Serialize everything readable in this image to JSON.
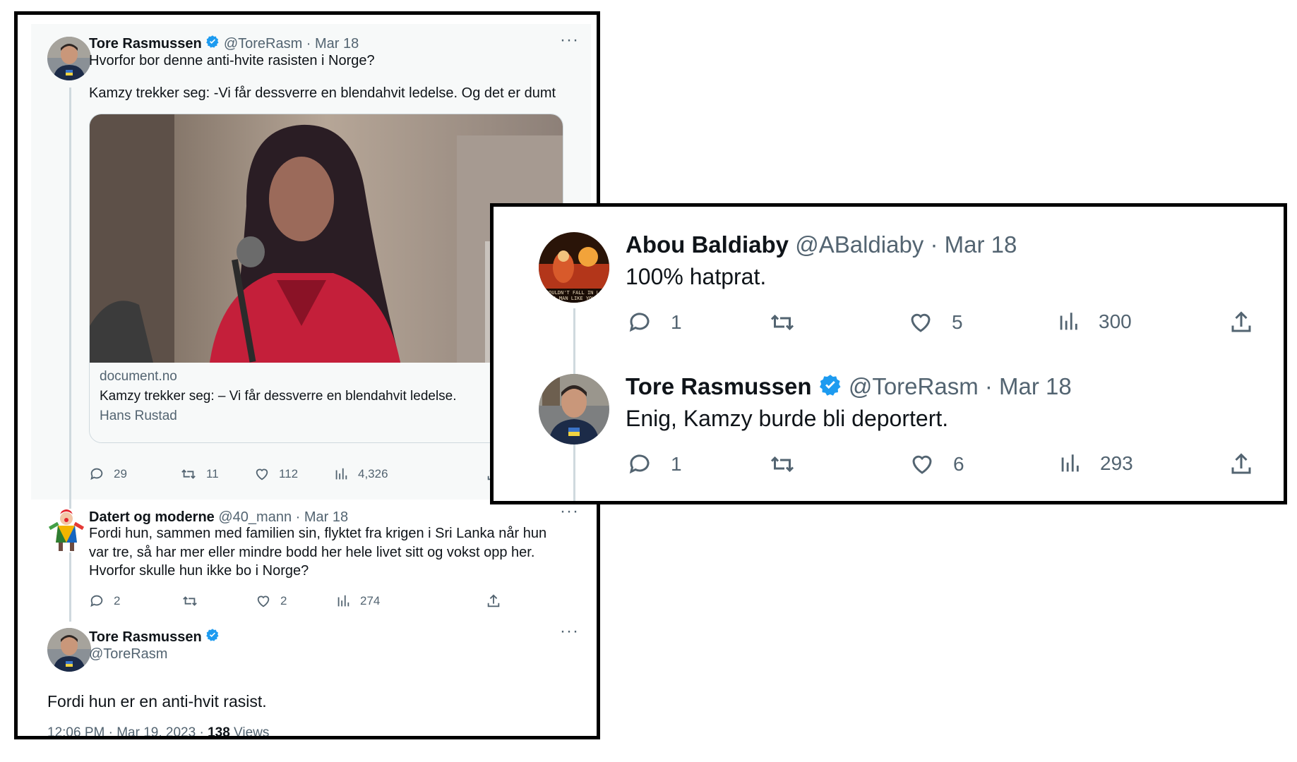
{
  "left": {
    "tweet1": {
      "name": "Tore Rasmussen",
      "handle_date": "@ToreRasm · Mar 18",
      "text_line1": "Hvorfor bor denne anti-hvite rasisten i Norge?",
      "text_line2": "Kamzy trekker seg: -Vi får dessverre en blendahvit ledelse. Og det er dumt",
      "card": {
        "domain": "document.no",
        "title": "Kamzy trekker seg: – Vi får dessverre en blendahvit ledelse.",
        "author": "Hans Rustad"
      },
      "replies": "29",
      "retweets": "11",
      "likes": "112",
      "views": "4,326"
    },
    "tweet2": {
      "name": "Datert og moderne",
      "handle_date": "@40_mann · Mar 18",
      "line1": "Fordi hun, sammen med familien sin, flyktet fra krigen i Sri Lanka når hun",
      "line2": "var tre, så har mer eller mindre bodd her hele livet sitt og vokst opp her.",
      "line3": "Hvorfor skulle hun ikke bo i Norge?",
      "replies": "2",
      "likes": "2",
      "views": "274"
    },
    "tweet3": {
      "name": "Tore Rasmussen",
      "handle": "@ToreRasm",
      "text": "Fordi hun er en anti-hvit rasist.",
      "timestamp": "12:06 PM · Mar 19, 2023 · ",
      "views_count": "138",
      "views_label": " Views"
    }
  },
  "right": {
    "tweet1": {
      "name": "Abou Baldiaby",
      "handle_date": "@ABaldiaby · Mar 18",
      "text": "100% hatprat.",
      "avatar_caption_1": "COULDN'T FALL IN LO",
      "avatar_caption_2": "A MAN LIKE YOU",
      "replies": "1",
      "likes": "5",
      "views": "300"
    },
    "tweet2": {
      "name": "Tore Rasmussen",
      "handle_date": "@ToreRasm · Mar 18",
      "text": "Enig, Kamzy burde bli deportert.",
      "replies": "1",
      "likes": "6",
      "views": "293"
    }
  },
  "colors": {
    "verified": "#1d9bf0",
    "muted": "#536471",
    "thread_line": "#cfd9de",
    "highlight_bg": "#f7f9f9"
  }
}
